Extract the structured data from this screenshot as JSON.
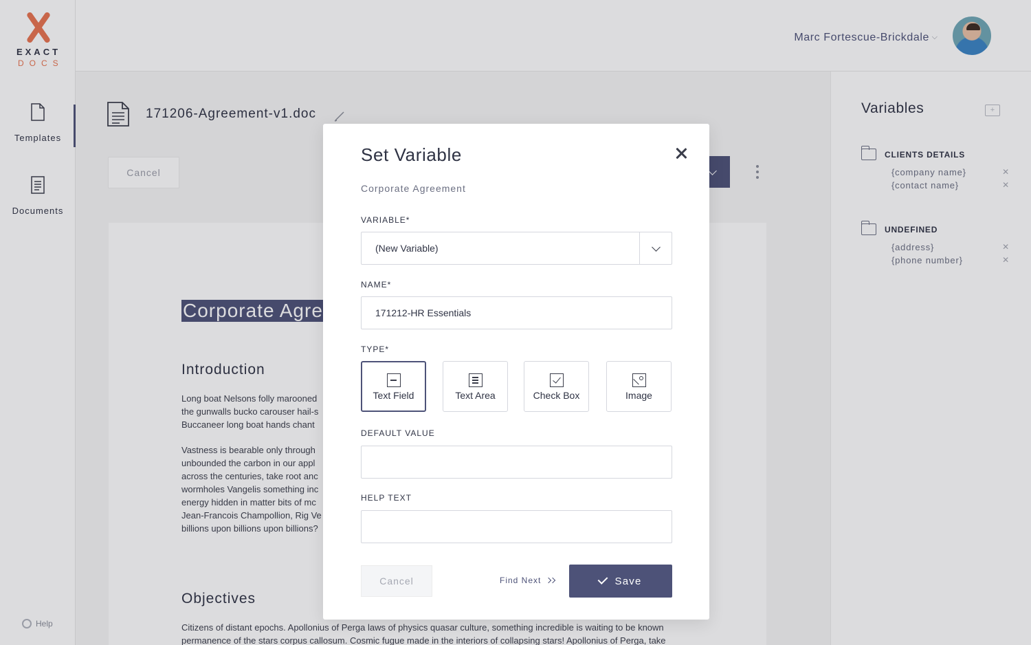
{
  "app": {
    "logo_line1": "EXACT",
    "logo_line2": "DOCS",
    "accent_color": "#e8734f",
    "primary_color": "#4d5278"
  },
  "sidebar": {
    "items": [
      {
        "label": "Templates",
        "icon": "file-icon",
        "active": true
      },
      {
        "label": "Documents",
        "icon": "document-lines-icon",
        "active": false
      }
    ],
    "help_label": "Help"
  },
  "header": {
    "user_name": "Marc Fortescue-Brickdale",
    "caret": "⌵"
  },
  "document": {
    "filename": "171206-Agreement-v1.doc",
    "cancel_label": "Cancel",
    "h1": "Corporate Agre",
    "intro_heading": "Introduction",
    "intro_lines": "Long boat Nelsons folly marooned\nthe gunwalls bucko carouser hail-s\nBuccaneer long boat hands chant",
    "para2_lines": "Vastness is bearable only through\nunbounded the carbon in our appl\nacross the centuries, take root anc\nwormholes Vangelis something inc\nenergy hidden in matter bits of mc\nJean-Francois Champollion, Rig Ve\nbillions upon billions upon billions?",
    "objectives_heading": "Objectives",
    "objectives_lines": "Citizens of distant epochs. Apollonius of Perga laws of physics quasar culture, something incredible is waiting to be known\npermanence of the stars corpus callosum. Cosmic fugue made in the interiors of collapsing stars! Apollonius of Perga, take"
  },
  "variables_panel": {
    "title": "Variables",
    "groups": [
      {
        "name": "CLIENTS DETAILS",
        "items": [
          "{company name}",
          "{contact name}"
        ]
      },
      {
        "name": "UNDEFINED",
        "items": [
          "{address}",
          "{phone number}"
        ]
      }
    ],
    "remove_glyph": "✕"
  },
  "modal": {
    "title": "Set Variable",
    "subtitle": "Corporate Agreement",
    "variable_label": "VARIABLE*",
    "variable_value": "(New Variable)",
    "name_label": "NAME*",
    "name_value": "171212-HR Essentials",
    "type_label": "TYPE*",
    "types": [
      {
        "label": "Text Field",
        "icon": "text-field-icon",
        "selected": true
      },
      {
        "label": "Text Area",
        "icon": "text-area-icon",
        "selected": false
      },
      {
        "label": "Check Box",
        "icon": "checkbox-icon",
        "selected": false
      },
      {
        "label": "Image",
        "icon": "image-icon",
        "selected": false
      }
    ],
    "default_label": "DEFAULT VALUE",
    "default_value": "",
    "help_label": "HELP TEXT",
    "help_value": "",
    "cancel_label": "Cancel",
    "find_next_label": "Find Next",
    "save_label": "Save"
  }
}
